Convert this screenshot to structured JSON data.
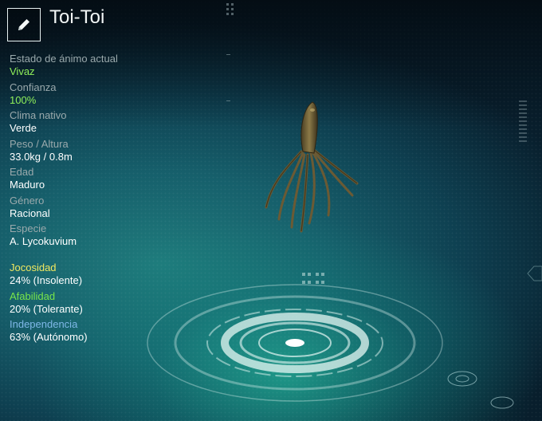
{
  "header": {
    "name": "Toi-Toi",
    "edit_icon": "pencil-icon"
  },
  "stats": [
    {
      "label": "Estado de ánimo actual",
      "value": "Vivaz",
      "highlight": true
    },
    {
      "label": "Confianza",
      "value": "100%",
      "highlight": true
    },
    {
      "label": "Clima nativo",
      "value": "Verde",
      "highlight": false
    },
    {
      "label": "Peso / Altura",
      "value": "33.0kg / 0.8m",
      "highlight": false
    },
    {
      "label": "Edad",
      "value": "Maduro",
      "highlight": false
    },
    {
      "label": "Género",
      "value": "Racional",
      "highlight": false
    },
    {
      "label": "Especie",
      "value": "A. Lycokuvium",
      "highlight": false
    }
  ],
  "traits": [
    {
      "label": "Jocosidad",
      "value": "24% (Insolente)",
      "color": "#f0e860"
    },
    {
      "label": "Afabilidad",
      "value": "20% (Tolerante)",
      "color": "#78e64a"
    },
    {
      "label": "Independencia",
      "value": "63% (Autónomo)",
      "color": "#7fb8e8"
    }
  ],
  "colors": {
    "highlight": "#8ff05a",
    "label": "#9aa9ac",
    "value": "#ffffff"
  }
}
